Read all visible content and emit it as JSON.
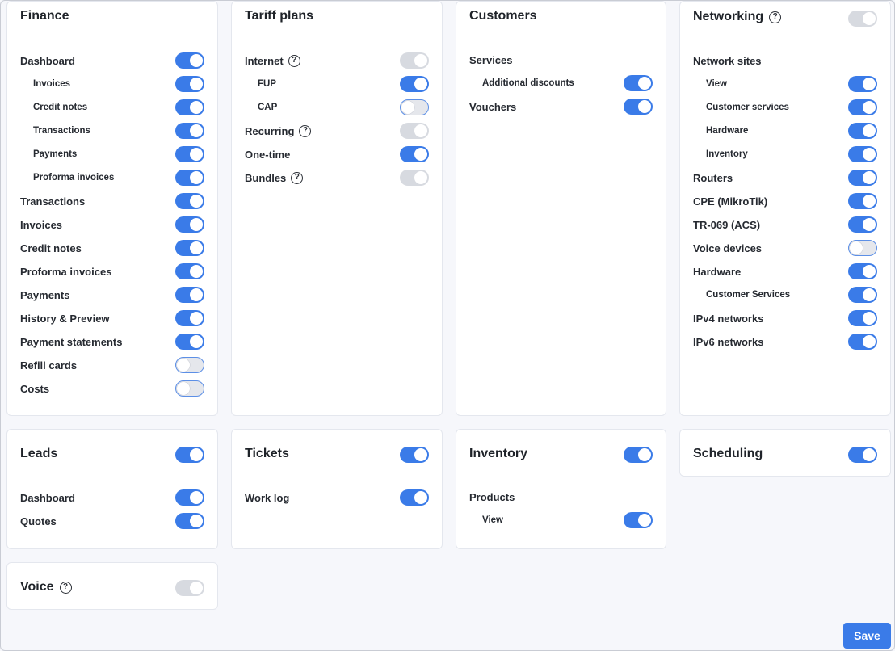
{
  "finance": {
    "title": "Finance",
    "rows": [
      {
        "label": "Dashboard",
        "state": "on",
        "sub": false
      },
      {
        "label": "Invoices",
        "state": "on",
        "sub": true
      },
      {
        "label": "Credit notes",
        "state": "on",
        "sub": true
      },
      {
        "label": "Transactions",
        "state": "on",
        "sub": true
      },
      {
        "label": "Payments",
        "state": "on",
        "sub": true
      },
      {
        "label": "Proforma invoices",
        "state": "on",
        "sub": true
      },
      {
        "label": "Transactions",
        "state": "on",
        "sub": false
      },
      {
        "label": "Invoices",
        "state": "on",
        "sub": false
      },
      {
        "label": "Credit notes",
        "state": "on",
        "sub": false
      },
      {
        "label": "Proforma invoices",
        "state": "on",
        "sub": false
      },
      {
        "label": "Payments",
        "state": "on",
        "sub": false
      },
      {
        "label": "History & Preview",
        "state": "on",
        "sub": false
      },
      {
        "label": "Payment statements",
        "state": "on",
        "sub": false
      },
      {
        "label": "Refill cards",
        "state": "off",
        "sub": false
      },
      {
        "label": "Costs",
        "state": "off",
        "sub": false
      }
    ]
  },
  "tariff_plans": {
    "title": "Tariff plans",
    "rows": [
      {
        "label": "Internet",
        "state": "disabled",
        "sub": false,
        "help": true
      },
      {
        "label": "FUP",
        "state": "on",
        "sub": true
      },
      {
        "label": "CAP",
        "state": "off",
        "sub": true
      },
      {
        "label": "Recurring",
        "state": "disabled",
        "sub": false,
        "help": true
      },
      {
        "label": "One-time",
        "state": "on",
        "sub": false
      },
      {
        "label": "Bundles",
        "state": "disabled",
        "sub": false,
        "help": true
      }
    ]
  },
  "customers": {
    "title": "Customers",
    "rows": [
      {
        "label": "Services",
        "state": "none",
        "sub": false
      },
      {
        "label": "Additional discounts",
        "state": "on",
        "sub": true
      },
      {
        "label": "Vouchers",
        "state": "on",
        "sub": false
      }
    ]
  },
  "networking": {
    "title": "Networking",
    "title_state": "disabled",
    "rows": [
      {
        "label": "Network sites",
        "state": "none",
        "sub": false
      },
      {
        "label": "View",
        "state": "on",
        "sub": true
      },
      {
        "label": "Customer services",
        "state": "on",
        "sub": true
      },
      {
        "label": "Hardware",
        "state": "on",
        "sub": true
      },
      {
        "label": "Inventory",
        "state": "on",
        "sub": true
      },
      {
        "label": "Routers",
        "state": "on",
        "sub": false
      },
      {
        "label": "CPE (MikroTik)",
        "state": "on",
        "sub": false
      },
      {
        "label": "TR-069 (ACS)",
        "state": "on",
        "sub": false
      },
      {
        "label": "Voice devices",
        "state": "off",
        "sub": false
      },
      {
        "label": "Hardware",
        "state": "on",
        "sub": false
      },
      {
        "label": "Customer Services",
        "state": "on",
        "sub": true
      },
      {
        "label": "IPv4 networks",
        "state": "on",
        "sub": false
      },
      {
        "label": "IPv6 networks",
        "state": "on",
        "sub": false
      }
    ]
  },
  "leads": {
    "title": "Leads",
    "title_state": "on",
    "rows": [
      {
        "label": "Dashboard",
        "state": "on",
        "sub": false
      },
      {
        "label": "Quotes",
        "state": "on",
        "sub": false
      }
    ]
  },
  "tickets": {
    "title": "Tickets",
    "title_state": "on",
    "rows": [
      {
        "label": "Work log",
        "state": "on",
        "sub": false
      }
    ]
  },
  "inventory": {
    "title": "Inventory",
    "title_state": "on",
    "rows": [
      {
        "label": "Products",
        "state": "none",
        "sub": false
      },
      {
        "label": "View",
        "state": "on",
        "sub": true
      }
    ]
  },
  "scheduling": {
    "title": "Scheduling",
    "title_state": "on"
  },
  "voice": {
    "title": "Voice",
    "title_state": "disabled"
  },
  "help_glyph": "?",
  "save_label": "Save",
  "colors": {
    "toggle_on": "#3a7be8",
    "toggle_disabled": "#d7dae0",
    "background": "#f6f7fb"
  }
}
